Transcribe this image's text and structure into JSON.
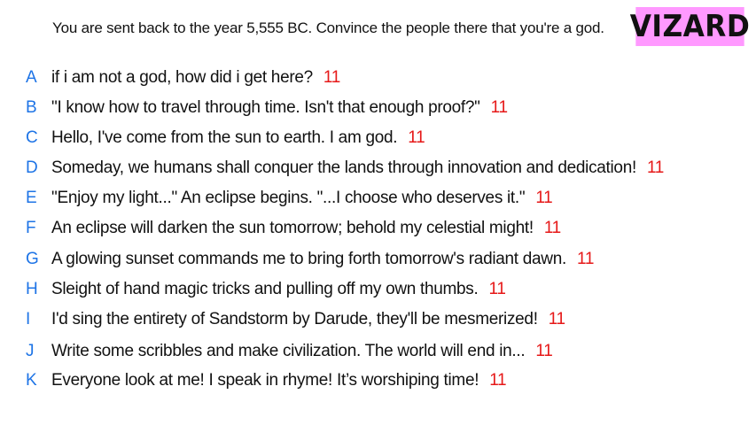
{
  "prompt": "You are sent back to the year 5,555 BC. Convince the people there that you're a god.",
  "logo": {
    "text": "VIZARD",
    "background": "#ff99ff"
  },
  "colors": {
    "letter": "#1e74e6",
    "score": "#e61818"
  },
  "answers": [
    {
      "letter": "A",
      "text": "if i am not a god, how did i get here?",
      "score": "11"
    },
    {
      "letter": "B",
      "text": "\"I know how to travel through time. Isn't that enough proof?\"",
      "score": "11"
    },
    {
      "letter": "C",
      "text": "Hello, I've come from the sun to earth. I am god.",
      "score": "11"
    },
    {
      "letter": "D",
      "text": "Someday, we humans shall conquer the lands through innovation and dedication!",
      "score": "11"
    },
    {
      "letter": "E",
      "text": "\"Enjoy my light...\" An eclipse begins. \"...I choose who deserves it.\"",
      "score": "11"
    },
    {
      "letter": "F",
      "text": "An eclipse will darken the sun tomorrow; behold my celestial might!",
      "score": "11"
    },
    {
      "letter": "G",
      "text": "A glowing sunset commands me to bring forth tomorrow's radiant dawn.",
      "score": "11"
    },
    {
      "letter": "H",
      "text": "Sleight of hand magic tricks and pulling off my own thumbs.",
      "score": "11"
    },
    {
      "letter": "I",
      "text": "I'd sing the entirety of Sandstorm by Darude, they'll be mesmerized!",
      "score": "11"
    },
    {
      "letter": "J",
      "text": "Write some scribbles and make civilization. The world will end in...",
      "score": "11"
    },
    {
      "letter": "K",
      "text": "Everyone look at me! I speak in rhyme! It’s worshiping time!",
      "score": "11"
    }
  ]
}
